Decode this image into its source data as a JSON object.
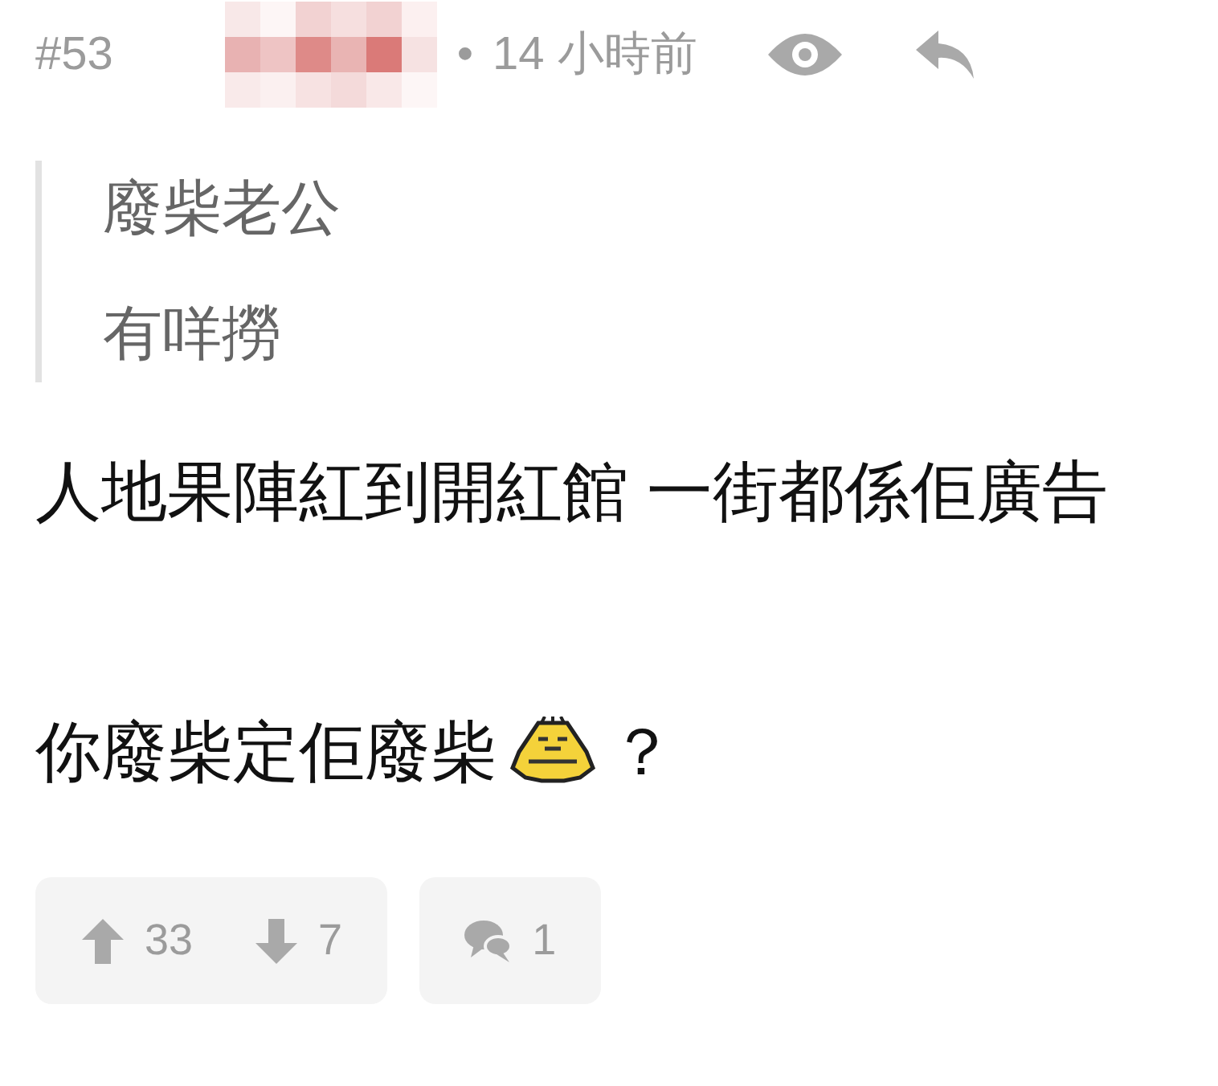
{
  "post": {
    "number": "#53",
    "separator": "•",
    "time": "14 小時前"
  },
  "quote": {
    "lines": [
      "廢柴老公",
      "有咩撈"
    ]
  },
  "body": [
    {
      "parts": [
        {
          "kind": "text",
          "text": "人地果陣紅到開紅館 一街都係佢廣告"
        }
      ]
    },
    {
      "parts": [
        {
          "kind": "text",
          "text": "你廢柴定佢廢柴"
        },
        {
          "kind": "sticker"
        },
        {
          "kind": "text",
          "text": "？"
        }
      ]
    }
  ],
  "votes": {
    "up": "33",
    "down": "7"
  },
  "replies": {
    "count": "1"
  }
}
